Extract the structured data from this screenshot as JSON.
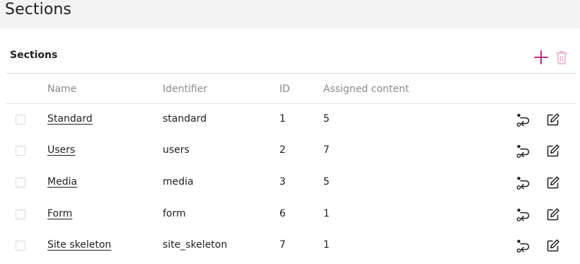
{
  "page": {
    "title": "Sections"
  },
  "panel": {
    "title": "Sections",
    "add_icon": "plus-icon",
    "delete_icon": "trash-icon",
    "accent_color": "#ae1164",
    "disabled_color": "#e9a8c8"
  },
  "table": {
    "columns": [
      "Name",
      "Identifier",
      "ID",
      "Assigned content"
    ],
    "rows": [
      {
        "name": "Standard",
        "identifier": "standard",
        "id": "1",
        "assigned": "5"
      },
      {
        "name": "Users",
        "identifier": "users",
        "id": "2",
        "assigned": "7"
      },
      {
        "name": "Media",
        "identifier": "media",
        "id": "3",
        "assigned": "5"
      },
      {
        "name": "Form",
        "identifier": "form",
        "id": "6",
        "assigned": "1"
      },
      {
        "name": "Site skeleton",
        "identifier": "site_skeleton",
        "id": "7",
        "assigned": "1"
      }
    ],
    "row_actions": [
      "assign-content-icon",
      "edit-icon"
    ]
  }
}
